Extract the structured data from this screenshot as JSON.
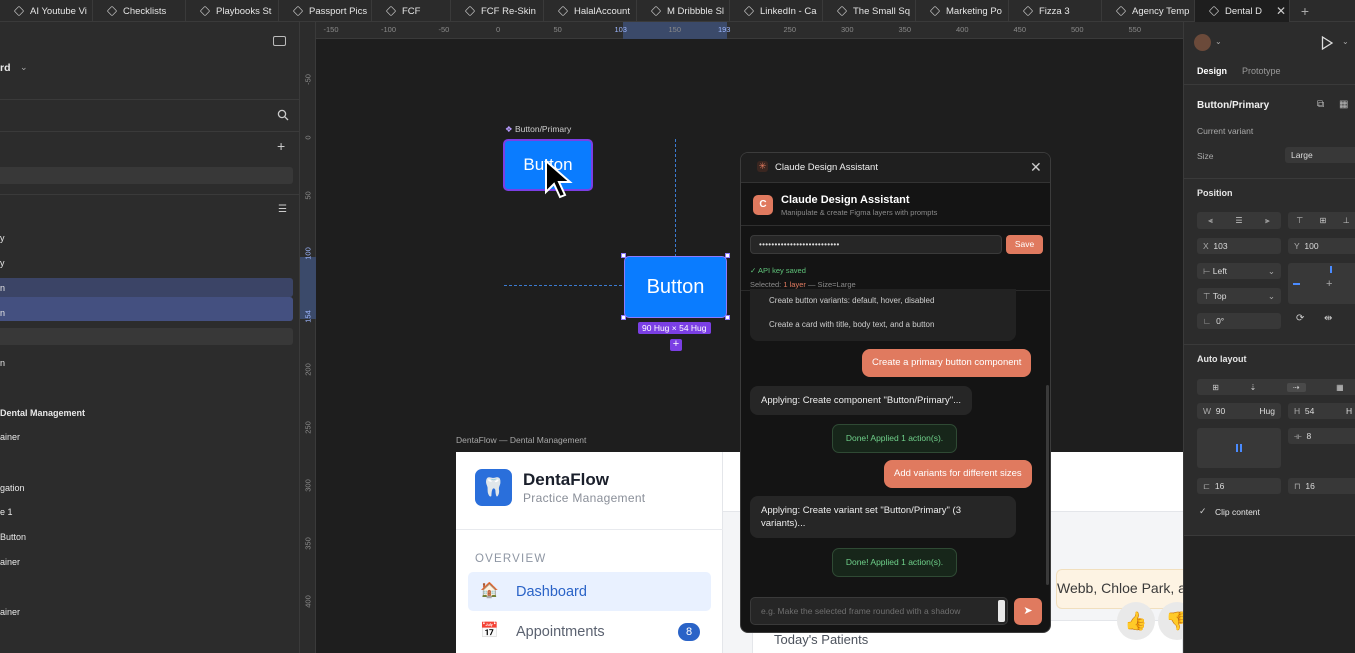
{
  "tabs": [
    "AI Youtube Vi",
    "Checklists",
    "Playbooks St",
    "Passport Pics",
    "FCF",
    "FCF Re-Skin",
    "HalalAccount",
    "M Dribbble Sl",
    "LinkedIn - Ca",
    "The Small Sq",
    "Marketing Po",
    "Fizza 3",
    "Agency Temp",
    "Dental D"
  ],
  "new_tab": "+",
  "left_panel": {
    "title_fragment": "rd",
    "layers": [
      "y",
      "y",
      "n",
      "n",
      "n",
      "Dental Management",
      "ainer",
      "gation",
      "e 1",
      "Button",
      "ainer",
      "ainer"
    ]
  },
  "ruler": {
    "h_ticks": [
      "-150",
      "-100",
      "-50",
      "0",
      "50",
      "103",
      "150",
      "193",
      "250",
      "300",
      "350",
      "400",
      "450",
      "500",
      "550"
    ],
    "v_ticks": [
      "-50",
      "0",
      "50",
      "100",
      "154",
      "200",
      "250",
      "300",
      "350",
      "400"
    ]
  },
  "canvas": {
    "component_label": "Button/Primary",
    "button_label": "Button",
    "size_badge": "90 Hug × 54 Hug",
    "frame_label": "DentaFlow — Dental Management",
    "app": {
      "name": "DentaFlow",
      "subtitle": "Practice Management",
      "section": "OVERVIEW",
      "nav": [
        {
          "icon": "🏠",
          "label": "Dashboard",
          "active": true
        },
        {
          "icon": "📅",
          "label": "Appointments",
          "badge": "8"
        }
      ],
      "banner_text": "Webb, Chloe Park, a",
      "card_title": "Today's Patients"
    }
  },
  "dialog": {
    "window_title": "Claude Design Assistant",
    "header_title": "Claude Design Assistant",
    "header_subtitle": "Manipulate & create Figma layers with prompts",
    "avatar_letter": "C",
    "api_key_masked": "••••••••••••••••••••••••••",
    "save_label": "Save",
    "status_saved": "✓ API key saved",
    "selected_prefix": "Selected: ",
    "selected_layer": "1 layer",
    "selected_suffix": " — Size=Large",
    "suggestions": [
      "Create button variants: default, hover, disabled",
      "Create a card with title, body text, and a button"
    ],
    "messages": [
      {
        "role": "user",
        "text": "Create a primary button component"
      },
      {
        "role": "assistant",
        "text": "Applying: Create component \"Button/Primary\"..."
      },
      {
        "role": "done",
        "text": "Done! Applied 1 action(s)."
      },
      {
        "role": "user",
        "text": "Add variants for different sizes"
      },
      {
        "role": "assistant",
        "text": "Applying: Create variant set \"Button/Primary\" (3 variants)..."
      },
      {
        "role": "done",
        "text": "Done! Applied 1 action(s)."
      }
    ],
    "input_placeholder": "e.g. Make the selected frame rounded with a shadow"
  },
  "right_panel": {
    "tabs": [
      "Design",
      "Prototype"
    ],
    "component_name": "Button/Primary",
    "current_variant_label": "Current variant",
    "size_label": "Size",
    "size_value": "Large",
    "position_title": "Position",
    "x_label": "X",
    "x_value": "103",
    "y_label": "Y",
    "y_value": "100",
    "h_constraint": "Left",
    "v_constraint": "Top",
    "rotation": "0°",
    "auto_layout_title": "Auto layout",
    "w_label": "W",
    "w_value": "90",
    "w_mode": "Hug",
    "h_label": "H",
    "h_value": "54",
    "h_mode": "H",
    "gap_value": "8",
    "padding_h": "16",
    "padding_v": "16",
    "clip_content": "Clip content"
  },
  "colors": {
    "accent": "#e07a5f",
    "selection": "#7b3fe4",
    "button_blue": "#0a7cff"
  }
}
